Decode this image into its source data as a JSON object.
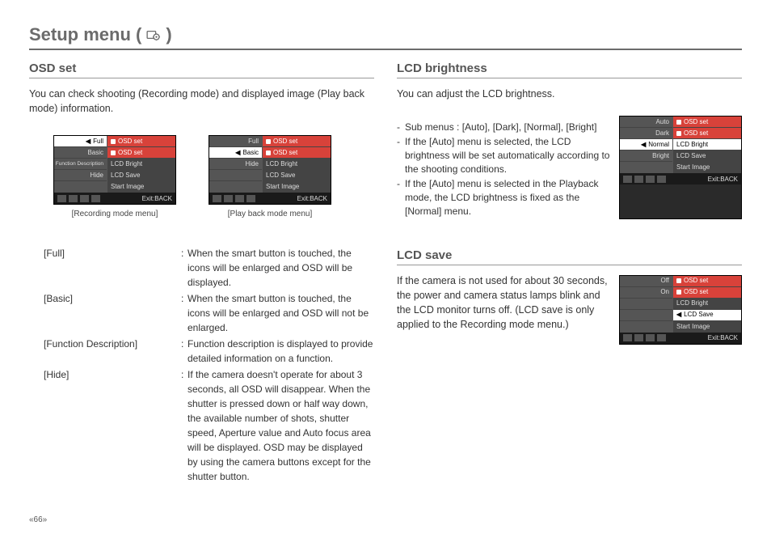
{
  "page": {
    "title_prefix": "Setup menu (",
    "title_suffix": ")",
    "page_number": "«66»"
  },
  "osd_set": {
    "heading": "OSD set",
    "intro": "You can check shooting (Recording  mode) and displayed image (Play back mode) information.",
    "menu_rec": {
      "caption": "[Recording mode menu]",
      "left": [
        "Full",
        "Basic",
        "Function Description",
        "Hide"
      ],
      "right": [
        "OSD set",
        "OSD set",
        "LCD Bright",
        "LCD Save",
        "Start Image"
      ],
      "exit": "Exit:BACK"
    },
    "menu_play": {
      "caption": "[Play back mode menu]",
      "left": [
        "Full",
        "Basic",
        "Hide"
      ],
      "right": [
        "OSD set",
        "OSD set",
        "LCD Bright",
        "LCD Save",
        "Start Image"
      ],
      "exit": "Exit:BACK"
    },
    "defs": [
      {
        "term": "[Full]",
        "desc": "When the smart button is touched, the icons will be enlarged and OSD will be displayed."
      },
      {
        "term": "[Basic]",
        "desc": "When the smart button is touched, the icons will be enlarged and OSD will not be enlarged."
      },
      {
        "term": "[Function Description]",
        "desc": "Function description is displayed to provide detailed information on a function."
      },
      {
        "term": "[Hide]",
        "desc": "If the camera doesn't operate for about 3 seconds, all OSD will disappear. When the shutter is pressed down or half way down, the available number of shots, shutter speed, Aperture value and Auto focus area will be displayed. OSD may be displayed by using the camera buttons except for the shutter button."
      }
    ]
  },
  "lcd_bright": {
    "heading": "LCD brightness",
    "intro": "You can adjust the LCD brightness.",
    "bullets": [
      "Sub menus : [Auto], [Dark], [Normal], [Bright]",
      "If the [Auto] menu is selected, the LCD brightness will be set automatically according to the shooting conditions.",
      "If the [Auto] menu is selected in the Playback mode, the LCD brightness is fixed as the [Normal] menu."
    ],
    "menu": {
      "left": [
        "Auto",
        "Dark",
        "Normal",
        "Bright"
      ],
      "right": [
        "OSD set",
        "OSD set",
        "LCD Bright",
        "LCD Save",
        "Start Image"
      ],
      "exit": "Exit:BACK"
    }
  },
  "lcd_save": {
    "heading": "LCD save",
    "intro": "If the camera is not used for about 30 seconds, the power and camera status lamps blink and the LCD monitor turns off. (LCD save is only applied to the Recording mode menu.)",
    "menu": {
      "left": [
        "Off",
        "On"
      ],
      "right": [
        "OSD set",
        "OSD set",
        "LCD Bright",
        "LCD Save",
        "Start Image"
      ],
      "exit": "Exit:BACK"
    }
  }
}
